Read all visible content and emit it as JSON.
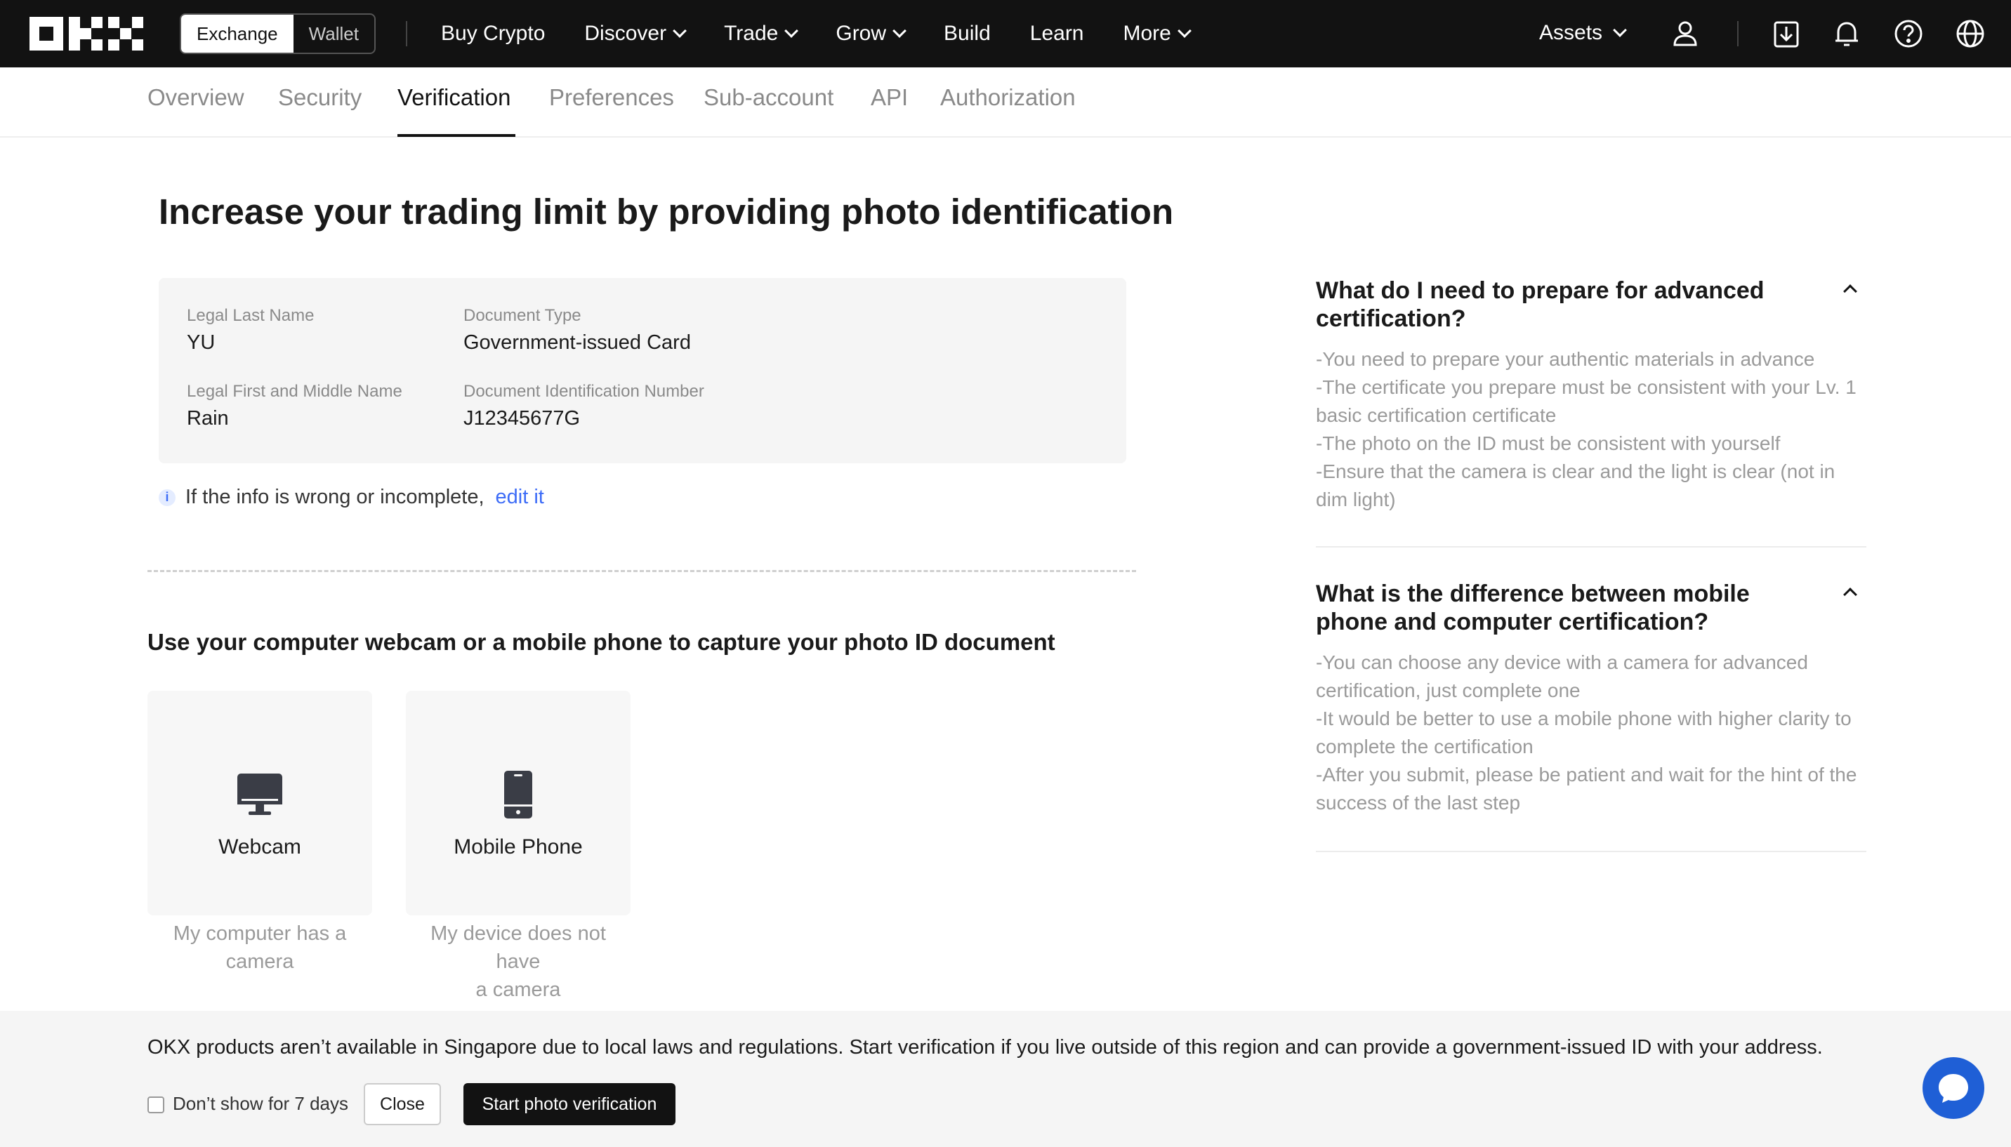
{
  "topnav": {
    "logo_text": "OKX",
    "switch": [
      "Exchange",
      "Wallet"
    ],
    "items": [
      {
        "label": "Buy Crypto",
        "dropdown": false
      },
      {
        "label": "Discover",
        "dropdown": true
      },
      {
        "label": "Trade",
        "dropdown": true
      },
      {
        "label": "Grow",
        "dropdown": true
      },
      {
        "label": "Build",
        "dropdown": false
      },
      {
        "label": "Learn",
        "dropdown": false
      },
      {
        "label": "More",
        "dropdown": true
      }
    ],
    "assets_label": "Assets",
    "icons": [
      "user-icon",
      "download-icon",
      "bell-icon",
      "help-icon",
      "globe-icon"
    ]
  },
  "subtabs": [
    "Overview",
    "Security",
    "Verification",
    "Preferences",
    "Sub-account",
    "API",
    "Authorization"
  ],
  "active_subtab": "Verification",
  "main": {
    "title": "Increase your trading limit by providing photo identification",
    "info": {
      "last_name_label": "Legal Last Name",
      "last_name": "YU",
      "first_name_label": "Legal First and Middle Name",
      "first_name": "Rain",
      "doc_type_label": "Document Type",
      "doc_type": "Government-issued Card",
      "doc_number_label": "Document Identification Number",
      "doc_number": "J12345677G"
    },
    "note_text": "If the info is wrong or incomplete,",
    "note_link": "edit it",
    "capture_heading": "Use your computer webcam or a mobile phone to capture your photo ID document",
    "devices": [
      {
        "label": "Webcam",
        "desc_line1": "My computer has a",
        "desc_line2": "camera",
        "icon": "monitor-icon"
      },
      {
        "label": "Mobile Phone",
        "desc_line1": "My device does not have",
        "desc_line2": "a camera",
        "icon": "phone-icon"
      }
    ]
  },
  "faq": [
    {
      "q": "What do I need to prepare for advanced certification?",
      "a": [
        "-You need to prepare your authentic materials in advance",
        "-The certificate you prepare must be consistent with your Lv. 1 basic certification certificate",
        "-The photo on the ID must be consistent with yourself",
        "-Ensure that the camera is clear and the light is clear (not in dim light)"
      ]
    },
    {
      "q": "What is the difference between mobile phone and computer certification?",
      "a": [
        "-You can choose any device with a camera for advanced certification, just complete one",
        "-It would be better to use a mobile phone with higher clarity to complete the certification",
        "-After you submit, please be patient and wait for the hint of the success of the last step"
      ]
    }
  ],
  "banner": {
    "text": "OKX products aren’t available in Singapore due to local laws and regulations. Start verification if you live outside of this region and can provide a government-issued ID with your address.",
    "checkbox_label": "Don’t show for 7 days",
    "close_label": "Close",
    "start_label": "Start photo verification"
  },
  "colors": {
    "topbar": "#121212",
    "link": "#3d6cf7",
    "chat": "#1f5fd6"
  }
}
